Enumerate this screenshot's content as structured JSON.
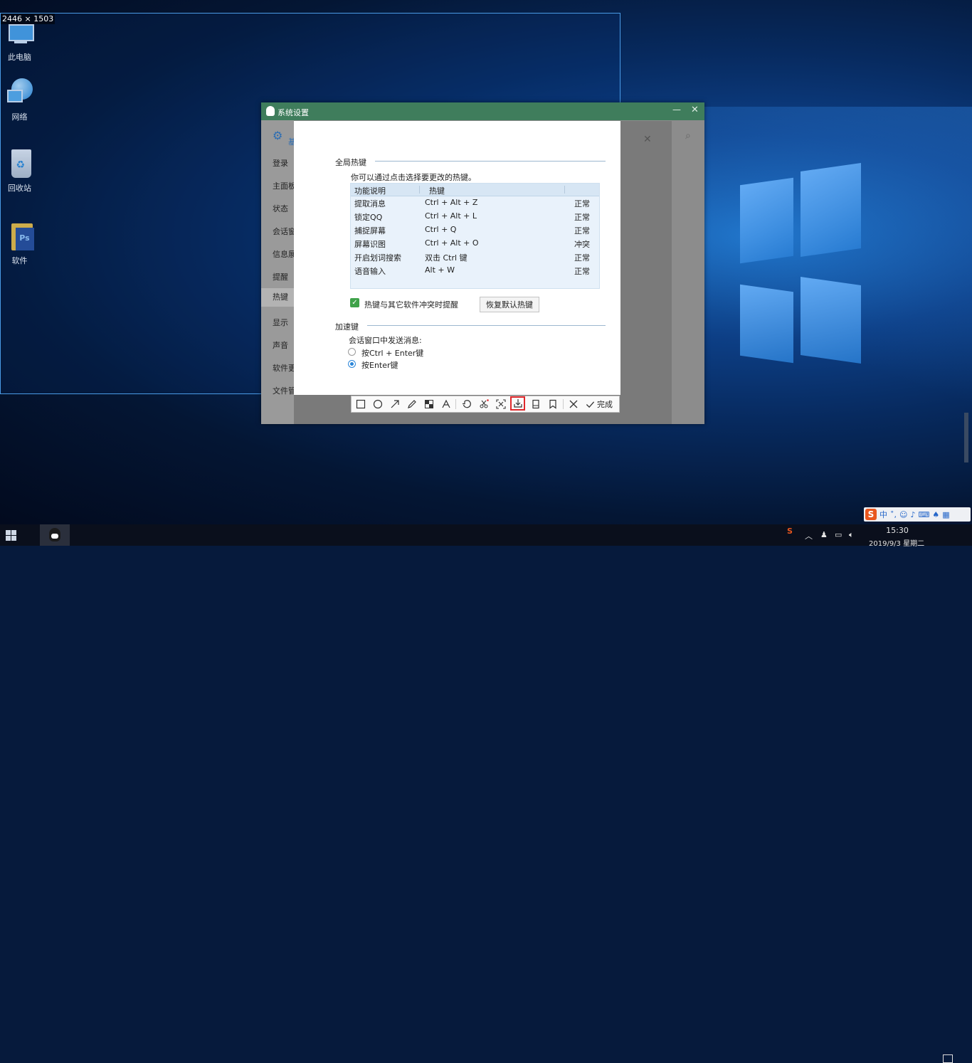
{
  "screenshot_size_label": "2446 × 1503",
  "desktop_icons": [
    {
      "label": "此电脑",
      "icon": "computer-icon"
    },
    {
      "label": "网络",
      "icon": "network-globe-icon"
    },
    {
      "label": "回收站",
      "icon": "recycle-bin-icon"
    },
    {
      "label": "软件",
      "icon": "photoshop-folder-icon"
    }
  ],
  "dialog": {
    "title": "系统设置",
    "side_heading_partial": "基",
    "side_items": [
      "登录",
      "主面板",
      "状态",
      "会话窗",
      "信息展",
      "提醒",
      "热键",
      "显示",
      "声音",
      "软件更",
      "文件管"
    ],
    "active_item": "热键"
  },
  "hotkeys": {
    "section_title": "全局热键",
    "hint": "你可以通过点击选择要更改的热键。",
    "columns": [
      "功能说明",
      "热键"
    ],
    "rows": [
      {
        "func": "提取消息",
        "key": "Ctrl + Alt + Z",
        "status": "正常"
      },
      {
        "func": "锁定QQ",
        "key": "Ctrl + Alt + L",
        "status": "正常"
      },
      {
        "func": "捕捉屏幕",
        "key": "Ctrl + Q",
        "status": "正常"
      },
      {
        "func": "屏幕识图",
        "key": "Ctrl + Alt + O",
        "status": "冲突"
      },
      {
        "func": "开启划词搜索",
        "key": "双击 Ctrl 键",
        "status": "正常"
      },
      {
        "func": "语音输入",
        "key": "Alt + W",
        "status": "正常"
      }
    ],
    "conflict_checkbox_label": "热键与其它软件冲突时提醒",
    "conflict_checkbox_checked": true,
    "restore_button": "恢复默认热键"
  },
  "accelerator": {
    "section_title": "加速键",
    "subtitle": "会话窗口中发送消息:",
    "options": [
      "按Ctrl + Enter键",
      "按Enter键"
    ],
    "selected_index": 1
  },
  "capture_toolbar": {
    "tools": [
      "rectangle-icon",
      "ellipse-icon",
      "arrow-icon",
      "pen-icon",
      "mosaic-icon",
      "text-icon",
      "undo-icon",
      "screenshot-share-icon",
      "ocr-icon",
      "pin-icon",
      "long-screenshot-icon",
      "bookmark-icon",
      "cancel-icon"
    ],
    "highlighted_tool": "pin-icon",
    "done_label": "完成"
  },
  "taskbar": {
    "time": "15:30",
    "date": "2019/9/3 星期二"
  },
  "ime": {
    "logo": "S",
    "mode": "中"
  }
}
